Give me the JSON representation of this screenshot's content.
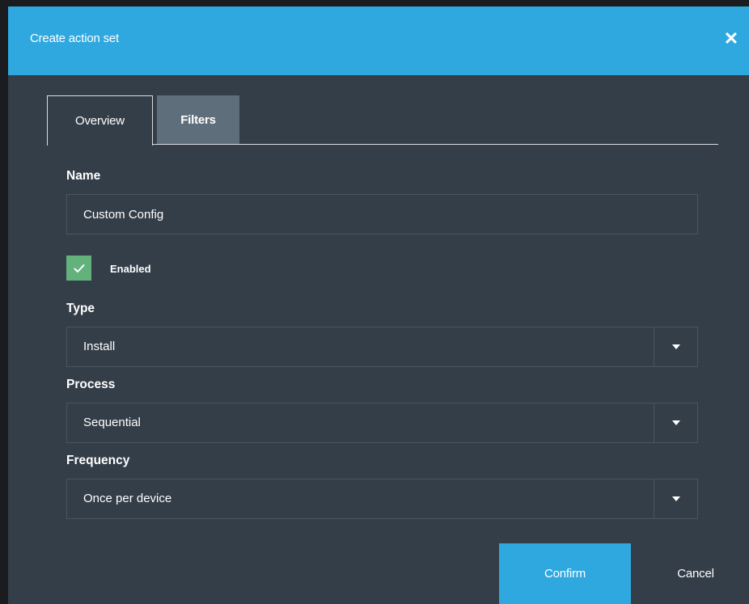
{
  "dialog": {
    "title": "Create action set",
    "close_icon": "close-icon"
  },
  "tabs": [
    {
      "label": "Overview",
      "active": true
    },
    {
      "label": "Filters",
      "active": false
    }
  ],
  "form": {
    "name": {
      "label": "Name",
      "value": "Custom Config"
    },
    "enabled": {
      "label": "Enabled",
      "checked": true
    },
    "type": {
      "label": "Type",
      "value": "Install"
    },
    "process": {
      "label": "Process",
      "value": "Sequential"
    },
    "frequency": {
      "label": "Frequency",
      "value": "Once per device"
    }
  },
  "actions": {
    "confirm_label": "Confirm",
    "cancel_label": "Cancel"
  },
  "colors": {
    "header": "#2ea8df",
    "body": "#343e48",
    "checkbox": "#63b27c",
    "inactive_tab": "#5f6e7b"
  }
}
